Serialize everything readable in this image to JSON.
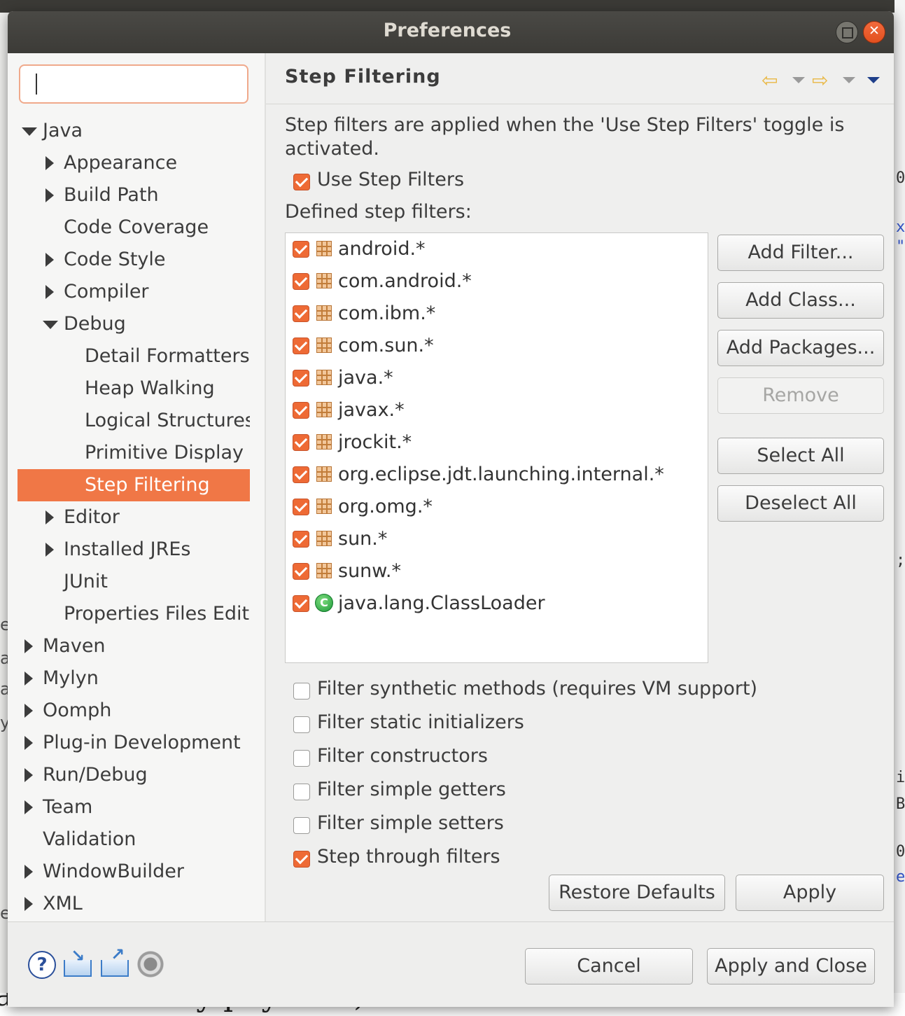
{
  "background": {
    "right_fragments": [
      "0",
      "x",
      "\"",
      ";",
      "ij",
      "Be",
      "00",
      "e"
    ],
    "left_fragments": [
      "e",
      "a",
      "a",
      "y",
      "e"
    ],
    "bottom_text": "ain eventually pays off.)"
  },
  "window": {
    "title": "Preferences"
  },
  "tree": {
    "filter_placeholder": "",
    "items": [
      {
        "label": "Java",
        "depth": 0,
        "expander": "expanded"
      },
      {
        "label": "Appearance",
        "depth": 1,
        "expander": "collapsed"
      },
      {
        "label": "Build Path",
        "depth": 1,
        "expander": "collapsed"
      },
      {
        "label": "Code Coverage",
        "depth": 1,
        "expander": "none"
      },
      {
        "label": "Code Style",
        "depth": 1,
        "expander": "collapsed"
      },
      {
        "label": "Compiler",
        "depth": 1,
        "expander": "collapsed"
      },
      {
        "label": "Debug",
        "depth": 1,
        "expander": "expanded"
      },
      {
        "label": "Detail Formatters",
        "depth": 2,
        "expander": "none"
      },
      {
        "label": "Heap Walking",
        "depth": 2,
        "expander": "none"
      },
      {
        "label": "Logical Structures",
        "depth": 2,
        "expander": "none"
      },
      {
        "label": "Primitive Display Options",
        "depth": 2,
        "expander": "none"
      },
      {
        "label": "Step Filtering",
        "depth": 2,
        "expander": "none",
        "selected": true
      },
      {
        "label": "Editor",
        "depth": 1,
        "expander": "collapsed"
      },
      {
        "label": "Installed JREs",
        "depth": 1,
        "expander": "collapsed"
      },
      {
        "label": "JUnit",
        "depth": 1,
        "expander": "none"
      },
      {
        "label": "Properties Files Editor",
        "depth": 1,
        "expander": "none"
      },
      {
        "label": "Maven",
        "depth": 0,
        "expander": "collapsed"
      },
      {
        "label": "Mylyn",
        "depth": 0,
        "expander": "collapsed"
      },
      {
        "label": "Oomph",
        "depth": 0,
        "expander": "collapsed"
      },
      {
        "label": "Plug-in Development",
        "depth": 0,
        "expander": "collapsed"
      },
      {
        "label": "Run/Debug",
        "depth": 0,
        "expander": "collapsed"
      },
      {
        "label": "Team",
        "depth": 0,
        "expander": "collapsed"
      },
      {
        "label": "Validation",
        "depth": 0,
        "expander": "none"
      },
      {
        "label": "WindowBuilder",
        "depth": 0,
        "expander": "collapsed"
      },
      {
        "label": "XML",
        "depth": 0,
        "expander": "collapsed"
      }
    ]
  },
  "page": {
    "title": "Step Filtering",
    "description": "Step filters are applied when the 'Use Step Filters' toggle is activated.",
    "use_step_filters": {
      "label": "Use Step Filters",
      "checked": true
    },
    "defined_label": "Defined step filters:",
    "filters": [
      {
        "label": "android.*",
        "checked": true,
        "icon": "package-icon"
      },
      {
        "label": "com.android.*",
        "checked": true,
        "icon": "package-icon"
      },
      {
        "label": "com.ibm.*",
        "checked": true,
        "icon": "package-icon"
      },
      {
        "label": "com.sun.*",
        "checked": true,
        "icon": "package-icon"
      },
      {
        "label": "java.*",
        "checked": true,
        "icon": "package-icon"
      },
      {
        "label": "javax.*",
        "checked": true,
        "icon": "package-icon"
      },
      {
        "label": "jrockit.*",
        "checked": true,
        "icon": "package-icon"
      },
      {
        "label": "org.eclipse.jdt.launching.internal.*",
        "checked": true,
        "icon": "package-icon"
      },
      {
        "label": "org.omg.*",
        "checked": true,
        "icon": "package-icon"
      },
      {
        "label": "sun.*",
        "checked": true,
        "icon": "package-icon"
      },
      {
        "label": "sunw.*",
        "checked": true,
        "icon": "package-icon"
      },
      {
        "label": "java.lang.ClassLoader",
        "checked": true,
        "icon": "class-icon"
      }
    ],
    "side_buttons": {
      "add_filter": "Add Filter...",
      "add_class": "Add Class...",
      "add_packages": "Add Packages...",
      "remove": "Remove",
      "select_all": "Select All",
      "deselect_all": "Deselect All"
    },
    "options": [
      {
        "label": "Filter synthetic methods (requires VM support)",
        "checked": false
      },
      {
        "label": "Filter static initializers",
        "checked": false
      },
      {
        "label": "Filter constructors",
        "checked": false
      },
      {
        "label": "Filter simple getters",
        "checked": false
      },
      {
        "label": "Filter simple setters",
        "checked": false
      },
      {
        "label": "Step through filters",
        "checked": true
      }
    ],
    "restore_defaults": "Restore Defaults",
    "apply": "Apply"
  },
  "footer": {
    "help_glyph": "?",
    "cancel": "Cancel",
    "apply_and_close": "Apply and Close"
  },
  "colors": {
    "accent": "#f07746",
    "checkbox_on": "#ee6a35",
    "titlebar": "#3c3b37"
  }
}
